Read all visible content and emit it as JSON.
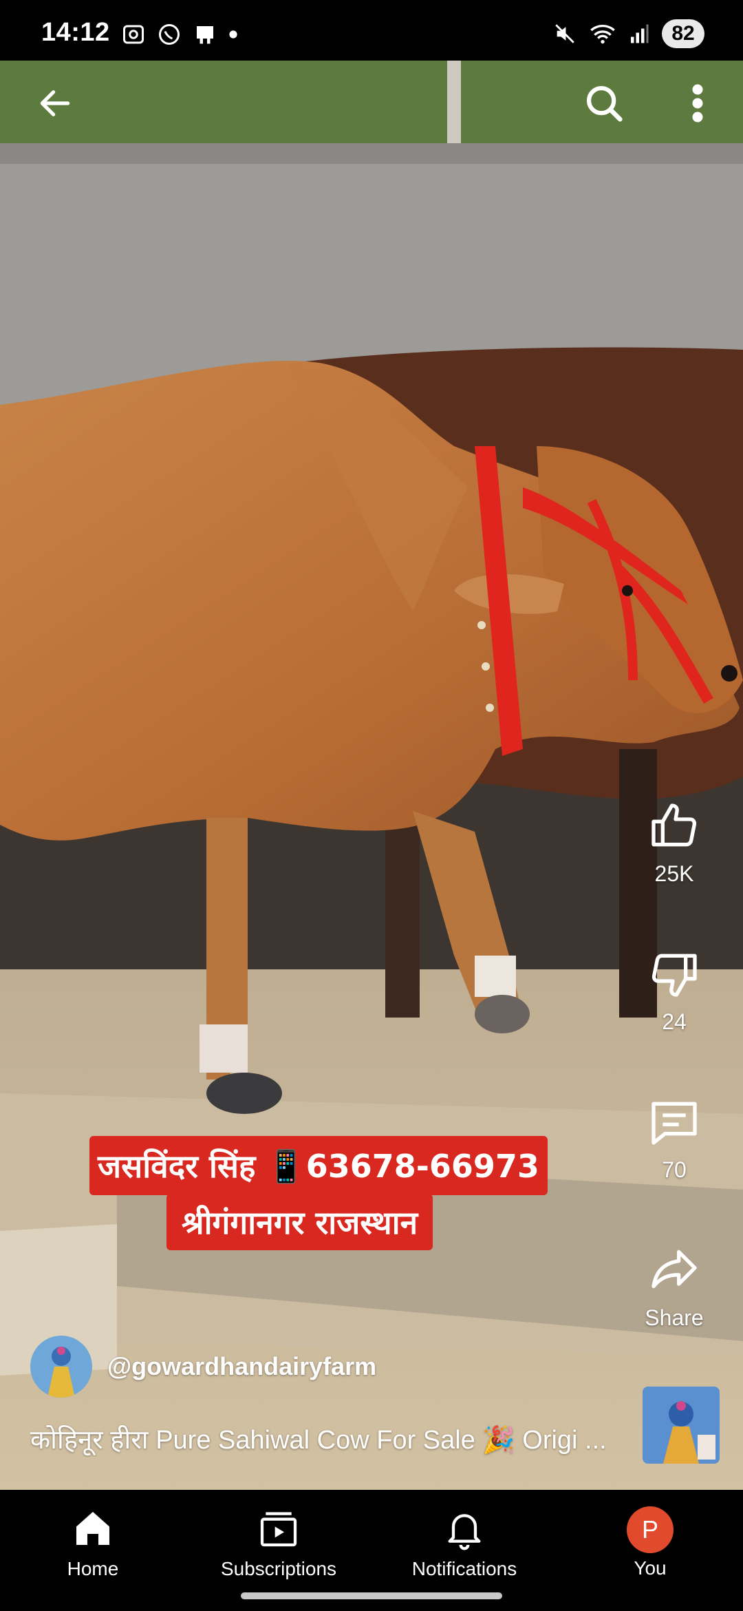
{
  "status_bar": {
    "time": "14:12",
    "battery": "82"
  },
  "video": {
    "caption_line1": "जसविंदर सिंह 📱63678-66973",
    "caption_line2": "श्रीगंगानगर राजस्थान"
  },
  "actions": {
    "likes": "25K",
    "dislikes": "24",
    "comments": "70",
    "share_label": "Share"
  },
  "channel": {
    "handle": "@gowardhandairyfarm"
  },
  "video_title": "कोहिनूर हीरा Pure Sahiwal Cow For Sale 🎉 Origi ...",
  "nav": [
    {
      "label": "Home"
    },
    {
      "label": "Subscriptions"
    },
    {
      "label": "Notifications"
    },
    {
      "label": "You",
      "avatar_letter": "P"
    }
  ],
  "colors": {
    "caption_red": "#d9281f",
    "you_avatar": "#e24a2e"
  }
}
